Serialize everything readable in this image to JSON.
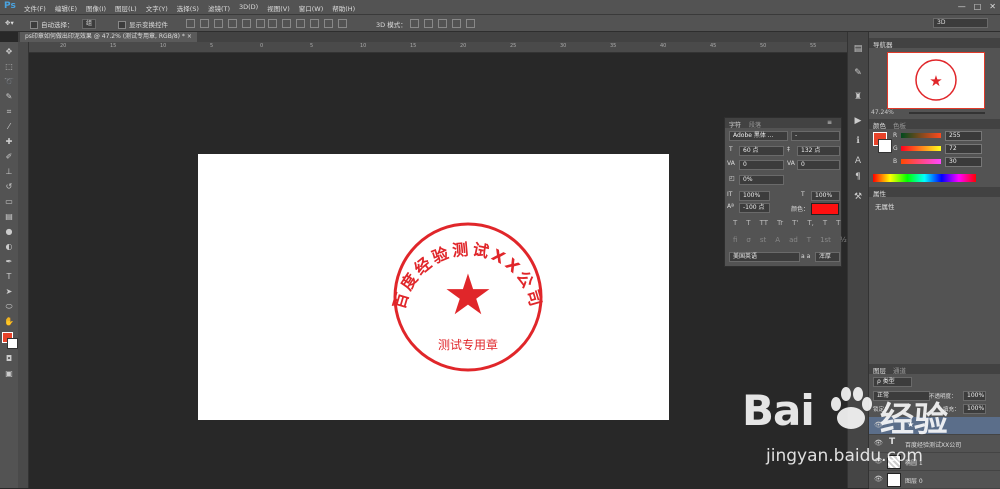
{
  "app": {
    "logo": "Ps"
  },
  "menu": [
    "文件(F)",
    "编辑(E)",
    "图像(I)",
    "图层(L)",
    "文字(Y)",
    "选择(S)",
    "滤镜(T)",
    "3D(D)",
    "视图(V)",
    "窗口(W)",
    "帮助(H)"
  ],
  "window_controls": [
    "—",
    "□",
    "✕"
  ],
  "options": {
    "auto_select_label": "自动选择：",
    "auto_select_value": "组",
    "show_transform_label": "显示变换控件",
    "mode_3d_label": "3D 模式：",
    "workspace": "3D"
  },
  "document": {
    "tab_title": "ps印章如何做出印泥效果 @ 47.2% (测试专用章, RGB/8) *"
  },
  "ruler_ticks": [
    "20",
    "15",
    "10",
    "5",
    "0",
    "5",
    "10",
    "15",
    "20",
    "25",
    "30",
    "35",
    "40",
    "45",
    "50",
    "55",
    "60"
  ],
  "stamp": {
    "arc_text": "百度经验测试XX公司",
    "center_text": "测试专用章",
    "star": "★",
    "color": "#e0262a"
  },
  "navigator": {
    "tab": "导航器",
    "zoom": "47.24%"
  },
  "color_panel": {
    "tabs": [
      "颜色",
      "色板"
    ],
    "r_label": "R",
    "g_label": "G",
    "b_label": "B",
    "r": "255",
    "g": "72",
    "b": "30",
    "foreground": "#e8432a"
  },
  "properties": {
    "tab": "属性",
    "content": "无属性"
  },
  "layers_panel": {
    "tabs": [
      "图层",
      "通道"
    ],
    "filter": "ρ 类型",
    "blend_mode": "正常",
    "opacity_label": "不透明度：",
    "opacity": "100%",
    "lock_label": "锁定：",
    "fill_label": "填充：",
    "fill": "100%",
    "layers": [
      {
        "name": "",
        "type": "star"
      },
      {
        "name": "百度经验测试XX公司",
        "type": "text"
      },
      {
        "name": "椭圆 1",
        "type": "shape"
      },
      {
        "name": "图层 0",
        "type": "raster"
      }
    ]
  },
  "character_panel": {
    "tabs": [
      "字符",
      "段落"
    ],
    "font_family": "Adobe 黑体 ...",
    "font_style": "-",
    "size": "60 点",
    "leading": "132 点",
    "kerning": "0",
    "tracking": "0",
    "scale_percent": "0%",
    "vertical_scale": "100%",
    "horizontal_scale": "100%",
    "baseline": "-100 点",
    "color_label": "颜色：",
    "text_color": "#ff1010",
    "style_buttons": [
      "T",
      "T",
      "TT",
      "Tr",
      "T'",
      "T,",
      "T",
      "T"
    ],
    "ot_buttons": [
      "fi",
      "σ",
      "st",
      "A",
      "ad",
      "T",
      "1st",
      "½"
    ],
    "language": "美国英语",
    "aa_label": "a a",
    "aa_value": "浑厚"
  },
  "watermark": {
    "brand_left": "Bai",
    "brand_right": "经验",
    "url": "jingyan.baidu.com"
  }
}
